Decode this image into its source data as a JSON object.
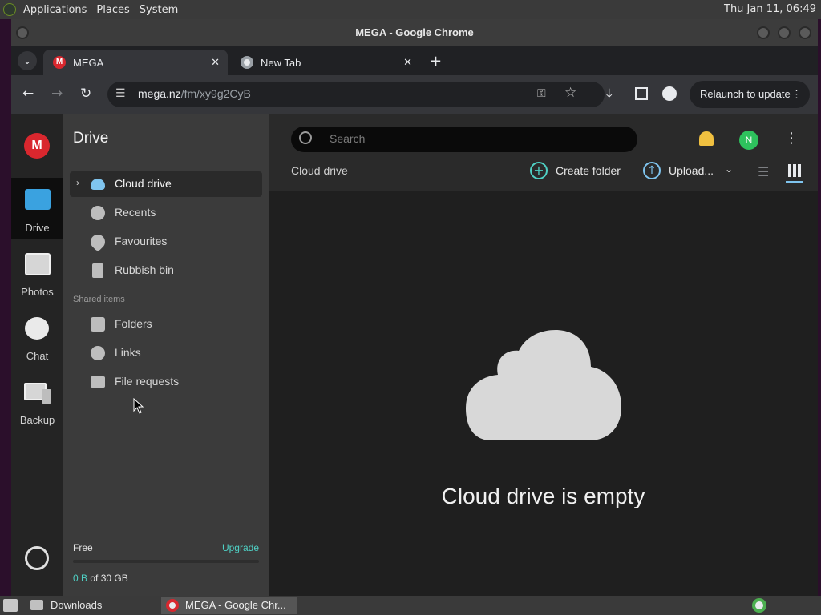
{
  "desktop": {
    "menu": [
      "Applications",
      "Places",
      "System"
    ],
    "clock": "Thu Jan 11, 06:49"
  },
  "window": {
    "title": "MEGA - Google Chrome"
  },
  "tabs": [
    {
      "label": "MEGA"
    },
    {
      "label": "New Tab"
    }
  ],
  "toolbar": {
    "url_host": "mega.nz",
    "url_path": "/fm/xy9g2CyB",
    "relaunch_label": "Relaunch to update"
  },
  "rail": {
    "items": [
      {
        "label": "Drive"
      },
      {
        "label": "Photos"
      },
      {
        "label": "Chat"
      },
      {
        "label": "Backup"
      }
    ]
  },
  "sidebar": {
    "title": "Drive",
    "nav": [
      {
        "label": "Cloud drive"
      },
      {
        "label": "Recents"
      },
      {
        "label": "Favourites"
      },
      {
        "label": "Rubbish bin"
      }
    ],
    "shared_header": "Shared items",
    "shared": [
      {
        "label": "Folders"
      },
      {
        "label": "Links"
      },
      {
        "label": "File requests"
      }
    ],
    "storage": {
      "plan": "Free",
      "upgrade": "Upgrade",
      "used": "0 B",
      "of_total": "of 30 GB",
      "used_fraction": 0
    }
  },
  "main": {
    "search_placeholder": "Search",
    "avatar_initial": "N",
    "breadcrumb": "Cloud drive",
    "create_folder": "Create folder",
    "upload": "Upload...",
    "empty_message": "Cloud drive is empty"
  },
  "taskbar": {
    "items": [
      {
        "label": "Downloads"
      },
      {
        "label": "MEGA - Google Chr..."
      }
    ]
  },
  "colors": {
    "mega_red": "#d9272e",
    "accent_teal": "#4fd1c5",
    "avatar_green": "#2ec25d"
  }
}
